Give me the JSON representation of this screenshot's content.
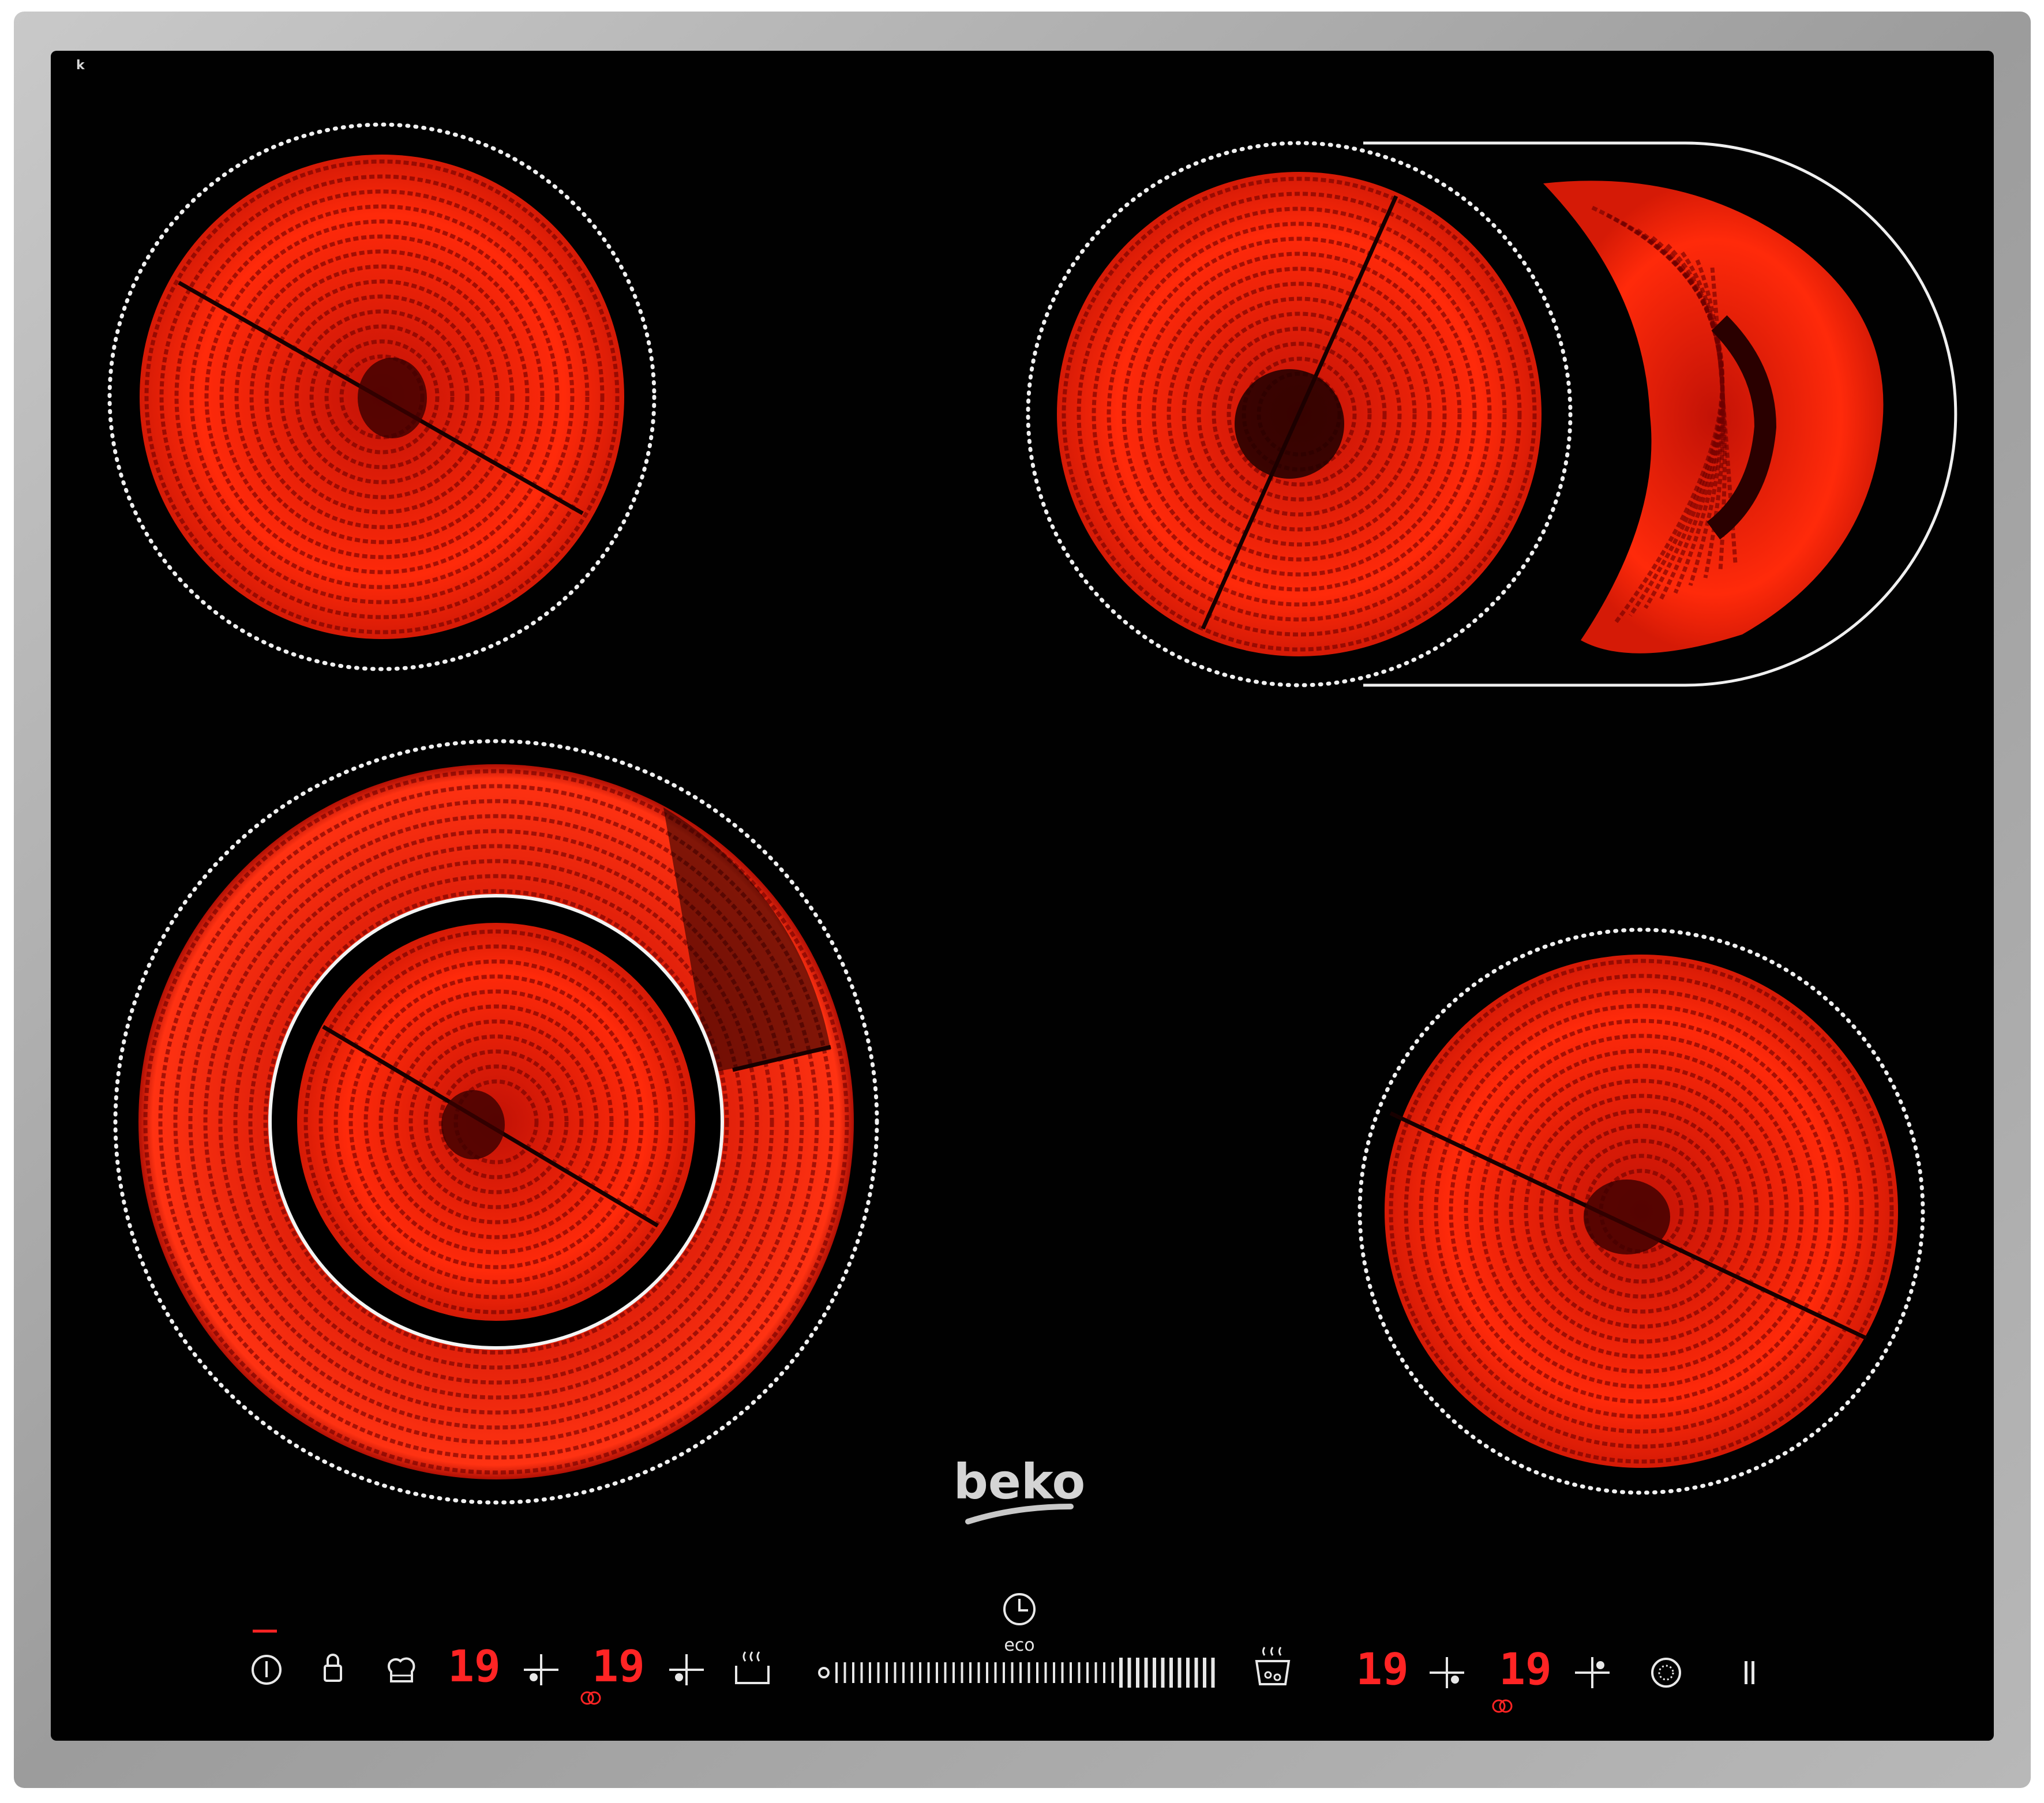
{
  "product": {
    "brand_logo": "beko",
    "corner_mark": "k",
    "eco_label": "eco"
  },
  "colors": {
    "glass": "#010101",
    "frame": "#a9a9a9",
    "element_glow": "#ff2a0a",
    "element_dark": "#5a0000",
    "display_red": "#ff2424",
    "control_white": "#e8e8e8"
  },
  "controls": {
    "left_group": [
      {
        "name": "power-button",
        "icon": "power-icon"
      },
      {
        "name": "lock-button",
        "icon": "lock-icon"
      },
      {
        "name": "chef-button",
        "icon": "chef-hat-icon"
      },
      {
        "name": "zone-1-display",
        "value": "19"
      },
      {
        "name": "zone-1-select",
        "icon": "zone-select-icon"
      },
      {
        "name": "zone-2-display",
        "value": "19"
      },
      {
        "name": "zone-2-select",
        "icon": "zone-select-icon"
      },
      {
        "name": "keep-warm-button",
        "icon": "keep-warm-icon"
      }
    ],
    "slider": {
      "name": "power-level-slider"
    },
    "eco_timer": {
      "name": "eco-timer-button",
      "icon": "clock-icon"
    },
    "right_group": [
      {
        "name": "boost-button",
        "icon": "boil-pot-icon"
      },
      {
        "name": "zone-3-display",
        "value": "19"
      },
      {
        "name": "zone-3-select",
        "icon": "zone-select-icon"
      },
      {
        "name": "zone-4-display",
        "value": "19"
      },
      {
        "name": "zone-4-select",
        "icon": "zone-select-icon"
      },
      {
        "name": "dual-zone-button",
        "icon": "dual-zone-icon"
      },
      {
        "name": "pause-button",
        "icon": "pause-icon"
      }
    ]
  }
}
